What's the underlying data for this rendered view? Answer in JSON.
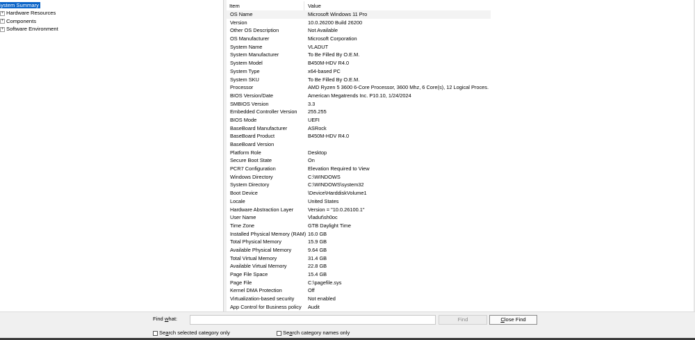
{
  "tree": {
    "items": [
      {
        "label": "System Summary",
        "expander": "",
        "selected": true
      },
      {
        "label": "Hardware Resources",
        "expander": "+"
      },
      {
        "label": "Components",
        "expander": "+"
      },
      {
        "label": "Software Environment",
        "expander": "+"
      }
    ]
  },
  "list": {
    "headers": {
      "item": "Item",
      "value": "Value"
    },
    "rows": [
      {
        "item": "OS Name",
        "value": "Microsoft Windows 11 Pro"
      },
      {
        "item": "Version",
        "value": "10.0.26200 Build 26200"
      },
      {
        "item": "Other OS Description",
        "value": "Not Available"
      },
      {
        "item": "OS Manufacturer",
        "value": "Microsoft Corporation"
      },
      {
        "item": "System Name",
        "value": "VLADUT"
      },
      {
        "item": "System Manufacturer",
        "value": "To Be Filled By O.E.M."
      },
      {
        "item": "System Model",
        "value": "B450M-HDV R4.0"
      },
      {
        "item": "System Type",
        "value": "x64-based PC"
      },
      {
        "item": "System SKU",
        "value": "To Be Filled By O.E.M."
      },
      {
        "item": "Processor",
        "value": "AMD Ryzen 5 3600 6-Core Processor, 3600 Mhz, 6 Core(s), 12 Logical Proces..."
      },
      {
        "item": "BIOS Version/Date",
        "value": "American Megatrends Inc. P10.10, 1/24/2024"
      },
      {
        "item": "SMBIOS Version",
        "value": "3.3"
      },
      {
        "item": "Embedded Controller Version",
        "value": "255.255"
      },
      {
        "item": "BIOS Mode",
        "value": "UEFI"
      },
      {
        "item": "BaseBoard Manufacturer",
        "value": "ASRock"
      },
      {
        "item": "BaseBoard Product",
        "value": "B450M-HDV R4.0"
      },
      {
        "item": "BaseBoard Version",
        "value": ""
      },
      {
        "item": "Platform Role",
        "value": "Desktop"
      },
      {
        "item": "Secure Boot State",
        "value": "On"
      },
      {
        "item": "PCR7 Configuration",
        "value": "Elevation Required to View"
      },
      {
        "item": "Windows Directory",
        "value": "C:\\WINDOWS"
      },
      {
        "item": "System Directory",
        "value": "C:\\WINDOWS\\system32"
      },
      {
        "item": "Boot Device",
        "value": "\\Device\\HarddiskVolume1"
      },
      {
        "item": "Locale",
        "value": "United States"
      },
      {
        "item": "Hardware Abstraction Layer",
        "value": "Version = \"10.0.26100.1\""
      },
      {
        "item": "User Name",
        "value": "Vladut\\sh0oc"
      },
      {
        "item": "Time Zone",
        "value": "GTB Daylight Time"
      },
      {
        "item": "Installed Physical Memory (RAM)",
        "value": "16.0 GB"
      },
      {
        "item": "Total Physical Memory",
        "value": "15.9 GB"
      },
      {
        "item": "Available Physical Memory",
        "value": "9.64 GB"
      },
      {
        "item": "Total Virtual Memory",
        "value": "31.4 GB"
      },
      {
        "item": "Available Virtual Memory",
        "value": "22.8 GB"
      },
      {
        "item": "Page File Space",
        "value": "15.4 GB"
      },
      {
        "item": "Page File",
        "value": "C:\\pagefile.sys"
      },
      {
        "item": "Kernel DMA Protection",
        "value": "Off"
      },
      {
        "item": "Virtualization-based security",
        "value": "Not enabled"
      },
      {
        "item": "App Control for Business policy",
        "value": "Audit"
      }
    ]
  },
  "find": {
    "label": "Find what:",
    "input_value": "",
    "find_button": "Find",
    "close_button": "Close Find",
    "search_selected_label": "Search selected category only",
    "search_names_label": "Search category names only"
  },
  "colors": {
    "selection": "#0a64c8",
    "first_row_bg": "#f3f3f3"
  }
}
